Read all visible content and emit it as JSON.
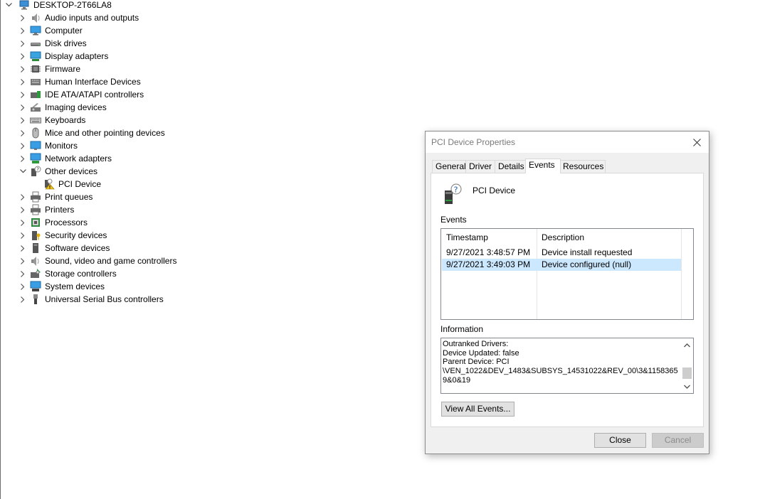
{
  "tree": {
    "root": "DESKTOP-2T66LA8",
    "items": [
      {
        "label": "Audio inputs and outputs",
        "icon": "speaker-icon"
      },
      {
        "label": "Computer",
        "icon": "computer-icon"
      },
      {
        "label": "Disk drives",
        "icon": "disk-drive-icon"
      },
      {
        "label": "Display adapters",
        "icon": "display-adapter-icon"
      },
      {
        "label": "Firmware",
        "icon": "firmware-icon"
      },
      {
        "label": "Human Interface Devices",
        "icon": "hid-icon"
      },
      {
        "label": "IDE ATA/ATAPI controllers",
        "icon": "ide-controller-icon"
      },
      {
        "label": "Imaging devices",
        "icon": "camera-icon"
      },
      {
        "label": "Keyboards",
        "icon": "keyboard-icon"
      },
      {
        "label": "Mice and other pointing devices",
        "icon": "mouse-icon"
      },
      {
        "label": "Monitors",
        "icon": "monitor-icon"
      },
      {
        "label": "Network adapters",
        "icon": "network-adapter-icon"
      },
      {
        "label": "Other devices",
        "icon": "unknown-device-icon"
      },
      {
        "label": "PCI Device",
        "icon": "warning-device-icon"
      },
      {
        "label": "Print queues",
        "icon": "print-queue-icon"
      },
      {
        "label": "Printers",
        "icon": "printer-icon"
      },
      {
        "label": "Processors",
        "icon": "processor-icon"
      },
      {
        "label": "Security devices",
        "icon": "security-device-icon"
      },
      {
        "label": "Software devices",
        "icon": "software-device-icon"
      },
      {
        "label": "Sound, video and game controllers",
        "icon": "sound-controller-icon"
      },
      {
        "label": "Storage controllers",
        "icon": "storage-controller-icon"
      },
      {
        "label": "System devices",
        "icon": "system-device-icon"
      },
      {
        "label": "Universal Serial Bus controllers",
        "icon": "usb-icon"
      }
    ]
  },
  "dialog": {
    "title": "PCI Device Properties",
    "tabs": [
      "General",
      "Driver",
      "Details",
      "Events",
      "Resources"
    ],
    "active_tab": "Events",
    "device_name": "PCI Device",
    "events_label": "Events",
    "columns": [
      "Timestamp",
      "Description"
    ],
    "events": [
      {
        "timestamp": "9/27/2021 3:48:57 PM",
        "description": "Device install requested"
      },
      {
        "timestamp": "9/27/2021 3:49:03 PM",
        "description": "Device configured (null)"
      }
    ],
    "selected_event": 1,
    "information_label": "Information",
    "information_text": "Outranked Drivers:\nDevice Updated: false\nParent Device: PCI\n\\VEN_1022&DEV_1483&SUBSYS_14531022&REV_00\\3&11583659&0&19",
    "view_all_button": "View All Events...",
    "close_button": "Close",
    "cancel_button": "Cancel"
  },
  "colors": {
    "selection": "#cce8ff",
    "accent": "#0078d7"
  }
}
